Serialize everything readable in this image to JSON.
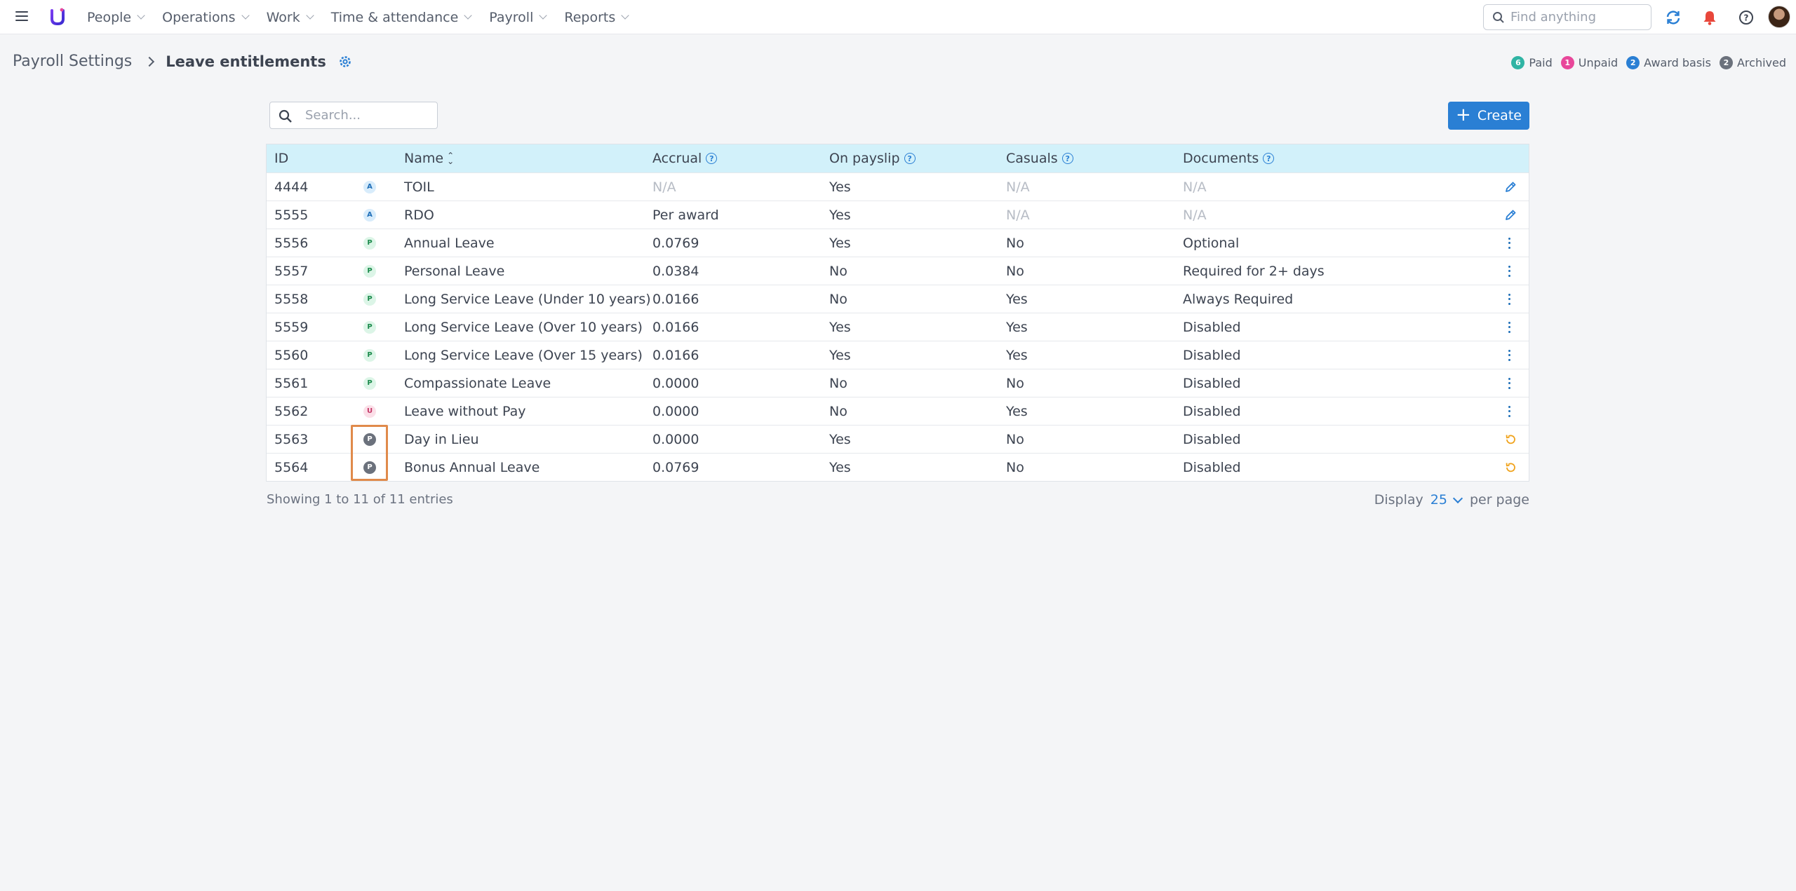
{
  "topbar": {
    "nav": [
      {
        "label": "People"
      },
      {
        "label": "Operations"
      },
      {
        "label": "Work"
      },
      {
        "label": "Time & attendance"
      },
      {
        "label": "Payroll"
      },
      {
        "label": "Reports"
      }
    ],
    "search_placeholder": "Find anything"
  },
  "header": {
    "breadcrumb_root": "Payroll Settings",
    "title": "Leave entitlements"
  },
  "legend": [
    {
      "count": "6",
      "label": "Paid",
      "color": "#2fb4a4"
    },
    {
      "count": "1",
      "label": "Unpaid",
      "color": "#e8479a"
    },
    {
      "count": "2",
      "label": "Award basis",
      "color": "#2a7fd4"
    },
    {
      "count": "2",
      "label": "Archived",
      "color": "#6b717c"
    }
  ],
  "toolbar": {
    "search_placeholder": "Search...",
    "create_label": "Create"
  },
  "table": {
    "columns": {
      "id": "ID",
      "name": "Name",
      "accrual": "Accrual",
      "payslip": "On payslip",
      "casuals": "Casuals",
      "documents": "Documents"
    },
    "rows": [
      {
        "id": "4444",
        "type": "A",
        "name": "TOIL",
        "accrual": "N/A",
        "payslip": "Yes",
        "casuals": "N/A",
        "documents": "N/A",
        "action": "edit"
      },
      {
        "id": "5555",
        "type": "A",
        "name": "RDO",
        "accrual": "Per award",
        "payslip": "Yes",
        "casuals": "N/A",
        "documents": "N/A",
        "action": "edit"
      },
      {
        "id": "5556",
        "type": "P",
        "name": "Annual Leave",
        "accrual": "0.0769",
        "payslip": "Yes",
        "casuals": "No",
        "documents": "Optional",
        "action": "menu"
      },
      {
        "id": "5557",
        "type": "P",
        "name": "Personal Leave",
        "accrual": "0.0384",
        "payslip": "No",
        "casuals": "No",
        "documents": "Required for 2+ days",
        "action": "menu"
      },
      {
        "id": "5558",
        "type": "P",
        "name": "Long Service Leave (Under 10 years)",
        "accrual": "0.0166",
        "payslip": "No",
        "casuals": "Yes",
        "documents": "Always Required",
        "action": "menu"
      },
      {
        "id": "5559",
        "type": "P",
        "name": "Long Service Leave (Over 10 years)",
        "accrual": "0.0166",
        "payslip": "Yes",
        "casuals": "Yes",
        "documents": "Disabled",
        "action": "menu"
      },
      {
        "id": "5560",
        "type": "P",
        "name": "Long Service Leave (Over 15 years)",
        "accrual": "0.0166",
        "payslip": "Yes",
        "casuals": "Yes",
        "documents": "Disabled",
        "action": "menu"
      },
      {
        "id": "5561",
        "type": "P",
        "name": "Compassionate Leave",
        "accrual": "0.0000",
        "payslip": "No",
        "casuals": "No",
        "documents": "Disabled",
        "action": "menu"
      },
      {
        "id": "5562",
        "type": "U",
        "name": "Leave without Pay",
        "accrual": "0.0000",
        "payslip": "No",
        "casuals": "Yes",
        "documents": "Disabled",
        "action": "menu"
      },
      {
        "id": "5563",
        "type": "P",
        "archived": true,
        "name": "Day in Lieu",
        "accrual": "0.0000",
        "payslip": "Yes",
        "casuals": "No",
        "documents": "Disabled",
        "action": "restore"
      },
      {
        "id": "5564",
        "type": "P",
        "archived": true,
        "name": "Bonus Annual Leave",
        "accrual": "0.0769",
        "payslip": "Yes",
        "casuals": "No",
        "documents": "Disabled",
        "action": "restore"
      }
    ]
  },
  "footer": {
    "summary": "Showing 1 to 11 of 11 entries",
    "display_label": "Display",
    "per_page_value": "25",
    "per_page_label": "per page"
  },
  "colors": {
    "accent": "#2a7fd4",
    "header_bg": "#d2f1fa",
    "restore_icon": "#f0a21a",
    "highlight": "#e08a4b",
    "notification": "#e8473b"
  }
}
